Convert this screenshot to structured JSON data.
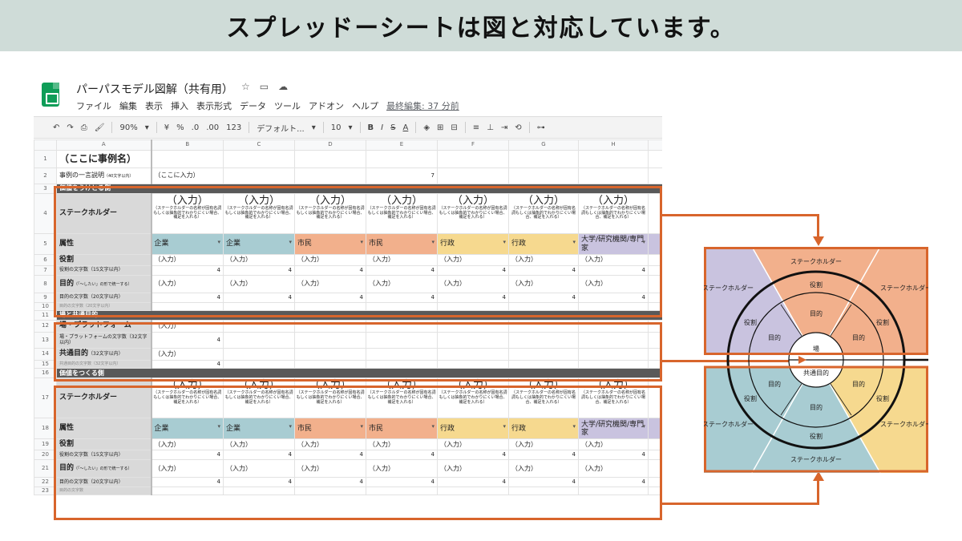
{
  "banner": {
    "title": "スプレッドーシートは図と対応しています。"
  },
  "sheet": {
    "title": "パーパスモデル図解（共有用）",
    "menu": [
      "ファイル",
      "編集",
      "表示",
      "挿入",
      "表示形式",
      "データ",
      "ツール",
      "アドオン",
      "ヘルプ"
    ],
    "last_edit": "最終編集: 37 分前",
    "toolbar": {
      "zoom": "90%",
      "currency": "¥",
      "percent": "%",
      "dec_less": ".0",
      "dec_more": ".00",
      "format": "123",
      "font": "デフォルト...",
      "font_size": "10"
    },
    "columns": [
      "A",
      "B",
      "C",
      "D",
      "E",
      "F",
      "G",
      "H"
    ],
    "row_numbers": [
      "1",
      "2",
      "3",
      "4",
      "5",
      "6",
      "7",
      "8",
      "9",
      "10",
      "11",
      "12",
      "13",
      "14",
      "15",
      "16",
      "17",
      "18",
      "19",
      "20",
      "21",
      "22",
      "23"
    ],
    "case_name": "（ここに事例名）",
    "summary_label": "事例の一言説明",
    "summary_note": "（40文字以内）",
    "summary_value": "（ここに入力）",
    "summary_count": "7",
    "sec_receive": "価値をうけとる側",
    "sec_place": "場と共通目的",
    "sec_create": "価値をつくる側",
    "stakeholder_label": "ステークホルダー",
    "stakeholder_input": "（入力）",
    "stakeholder_hint": "（ステークホルダーの名称が固有名詞もしくは抽象的でわかりにくい場合、補足を入れる）",
    "attribute_label": "属性",
    "attributes": [
      "企業",
      "企業",
      "市民",
      "市民",
      "行政",
      "行政",
      "大学/研究機関/専門家"
    ],
    "role_label": "役割",
    "role_count_label": "役割の文字数（15文字以内）",
    "purpose_label": "目的",
    "purpose_note": "（「〜したい」の形で統一する）",
    "purpose_count_label": "目的の文字数（20文字以内）",
    "input": "（入力）",
    "count_value": "4",
    "place_label": "場・プラットフォーム",
    "place_count_label": "場・プラットフォームの文字数（32文字以内）",
    "common_label": "共通目的",
    "common_note": "（32文字以内）",
    "row10_text": "目的の文字数（20文字以内）",
    "row15_text": "共通目的の文字数（32文字以内）",
    "row23_text": "目的の文字数"
  },
  "diagram": {
    "stakeholder": "ステークホルダー",
    "role": "役割",
    "purpose": "目的",
    "place": "場",
    "common_purpose": "共通目的",
    "colors": {
      "purple": "#c9c3df",
      "salmon": "#f2b08c",
      "teal": "#a8ccd2",
      "yellow": "#f6d98f",
      "accent": "#d8652c"
    }
  }
}
